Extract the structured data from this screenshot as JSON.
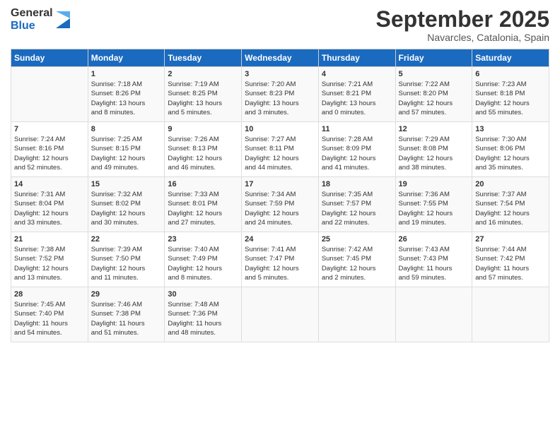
{
  "logo": {
    "general": "General",
    "blue": "Blue"
  },
  "title": "September 2025",
  "subtitle": "Navarcles, Catalonia, Spain",
  "headers": [
    "Sunday",
    "Monday",
    "Tuesday",
    "Wednesday",
    "Thursday",
    "Friday",
    "Saturday"
  ],
  "weeks": [
    [
      {
        "day": "",
        "info": ""
      },
      {
        "day": "1",
        "info": "Sunrise: 7:18 AM\nSunset: 8:26 PM\nDaylight: 13 hours\nand 8 minutes."
      },
      {
        "day": "2",
        "info": "Sunrise: 7:19 AM\nSunset: 8:25 PM\nDaylight: 13 hours\nand 5 minutes."
      },
      {
        "day": "3",
        "info": "Sunrise: 7:20 AM\nSunset: 8:23 PM\nDaylight: 13 hours\nand 3 minutes."
      },
      {
        "day": "4",
        "info": "Sunrise: 7:21 AM\nSunset: 8:21 PM\nDaylight: 13 hours\nand 0 minutes."
      },
      {
        "day": "5",
        "info": "Sunrise: 7:22 AM\nSunset: 8:20 PM\nDaylight: 12 hours\nand 57 minutes."
      },
      {
        "day": "6",
        "info": "Sunrise: 7:23 AM\nSunset: 8:18 PM\nDaylight: 12 hours\nand 55 minutes."
      }
    ],
    [
      {
        "day": "7",
        "info": "Sunrise: 7:24 AM\nSunset: 8:16 PM\nDaylight: 12 hours\nand 52 minutes."
      },
      {
        "day": "8",
        "info": "Sunrise: 7:25 AM\nSunset: 8:15 PM\nDaylight: 12 hours\nand 49 minutes."
      },
      {
        "day": "9",
        "info": "Sunrise: 7:26 AM\nSunset: 8:13 PM\nDaylight: 12 hours\nand 46 minutes."
      },
      {
        "day": "10",
        "info": "Sunrise: 7:27 AM\nSunset: 8:11 PM\nDaylight: 12 hours\nand 44 minutes."
      },
      {
        "day": "11",
        "info": "Sunrise: 7:28 AM\nSunset: 8:09 PM\nDaylight: 12 hours\nand 41 minutes."
      },
      {
        "day": "12",
        "info": "Sunrise: 7:29 AM\nSunset: 8:08 PM\nDaylight: 12 hours\nand 38 minutes."
      },
      {
        "day": "13",
        "info": "Sunrise: 7:30 AM\nSunset: 8:06 PM\nDaylight: 12 hours\nand 35 minutes."
      }
    ],
    [
      {
        "day": "14",
        "info": "Sunrise: 7:31 AM\nSunset: 8:04 PM\nDaylight: 12 hours\nand 33 minutes."
      },
      {
        "day": "15",
        "info": "Sunrise: 7:32 AM\nSunset: 8:02 PM\nDaylight: 12 hours\nand 30 minutes."
      },
      {
        "day": "16",
        "info": "Sunrise: 7:33 AM\nSunset: 8:01 PM\nDaylight: 12 hours\nand 27 minutes."
      },
      {
        "day": "17",
        "info": "Sunrise: 7:34 AM\nSunset: 7:59 PM\nDaylight: 12 hours\nand 24 minutes."
      },
      {
        "day": "18",
        "info": "Sunrise: 7:35 AM\nSunset: 7:57 PM\nDaylight: 12 hours\nand 22 minutes."
      },
      {
        "day": "19",
        "info": "Sunrise: 7:36 AM\nSunset: 7:55 PM\nDaylight: 12 hours\nand 19 minutes."
      },
      {
        "day": "20",
        "info": "Sunrise: 7:37 AM\nSunset: 7:54 PM\nDaylight: 12 hours\nand 16 minutes."
      }
    ],
    [
      {
        "day": "21",
        "info": "Sunrise: 7:38 AM\nSunset: 7:52 PM\nDaylight: 12 hours\nand 13 minutes."
      },
      {
        "day": "22",
        "info": "Sunrise: 7:39 AM\nSunset: 7:50 PM\nDaylight: 12 hours\nand 11 minutes."
      },
      {
        "day": "23",
        "info": "Sunrise: 7:40 AM\nSunset: 7:49 PM\nDaylight: 12 hours\nand 8 minutes."
      },
      {
        "day": "24",
        "info": "Sunrise: 7:41 AM\nSunset: 7:47 PM\nDaylight: 12 hours\nand 5 minutes."
      },
      {
        "day": "25",
        "info": "Sunrise: 7:42 AM\nSunset: 7:45 PM\nDaylight: 12 hours\nand 2 minutes."
      },
      {
        "day": "26",
        "info": "Sunrise: 7:43 AM\nSunset: 7:43 PM\nDaylight: 11 hours\nand 59 minutes."
      },
      {
        "day": "27",
        "info": "Sunrise: 7:44 AM\nSunset: 7:42 PM\nDaylight: 11 hours\nand 57 minutes."
      }
    ],
    [
      {
        "day": "28",
        "info": "Sunrise: 7:45 AM\nSunset: 7:40 PM\nDaylight: 11 hours\nand 54 minutes."
      },
      {
        "day": "29",
        "info": "Sunrise: 7:46 AM\nSunset: 7:38 PM\nDaylight: 11 hours\nand 51 minutes."
      },
      {
        "day": "30",
        "info": "Sunrise: 7:48 AM\nSunset: 7:36 PM\nDaylight: 11 hours\nand 48 minutes."
      },
      {
        "day": "",
        "info": ""
      },
      {
        "day": "",
        "info": ""
      },
      {
        "day": "",
        "info": ""
      },
      {
        "day": "",
        "info": ""
      }
    ]
  ]
}
